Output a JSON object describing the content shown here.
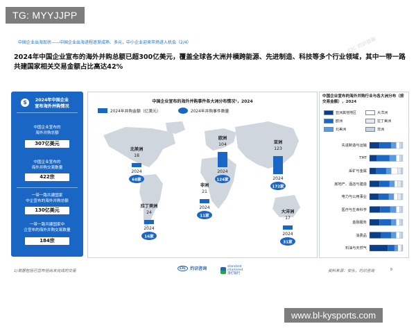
{
  "watermark_top": "TG: MYYJJPP",
  "watermark_bottom": "www.bl-kysports.com",
  "breadcrumb": "中国企业出海现状——中国企业出海进程逐渐成熟、多元，中小企业迎来市场进入机会（2/4）",
  "title": "2024年中国企业宣布的海外并购总额已超300亿美元，覆盖全球各大洲并横跨能源、先进制造、科技等多个行业领域，其中一带一路共建国家相关交易金额占比高达42%",
  "left_panel": {
    "heading_lines": [
      "2024年中国企业",
      "宣布海外并购情况"
    ],
    "icon": "money-icon",
    "items": [
      {
        "label_lines": [
          "中国企业宣布的",
          "海外并购总额"
        ],
        "value": "307亿美元"
      },
      {
        "label_lines": [
          "中国企业宣布的",
          "海外并购交易数量"
        ],
        "value": "422宗"
      },
      {
        "label_lines": [
          "一带一路共建国家",
          "中企宣布的海外并购总额"
        ],
        "value": "130亿美元"
      },
      {
        "label_lines": [
          "一带一路共建国家中",
          "企宣布的海外并购交易数量"
        ],
        "value": "184宗"
      }
    ]
  },
  "map": {
    "title": "中国企业宣布的海外并购事件各大洲分布情况¹，2024",
    "legend_amount": "2024年并购金额（亿美元）",
    "legend_count": "2024年并购事件数量"
  },
  "chart_data": [
    {
      "type": "bar",
      "title": "中国企业宣布的海外并购事件各大洲分布情况¹，2024",
      "categories": [
        "北美洲",
        "欧洲",
        "亚洲",
        "非洲",
        "拉丁美洲",
        "大洋洲"
      ],
      "series": [
        {
          "name": "2024年并购金额（亿美元）",
          "values": [
            18,
            104,
            123,
            21,
            24,
            17
          ]
        },
        {
          "name": "2024年并购事件数量",
          "values": [
            68,
            124,
            172,
            11,
            16,
            31
          ]
        }
      ],
      "x_label": "2024",
      "count_labels": [
        "68家",
        "124家",
        "172家",
        "11家",
        "16家",
        "31家"
      ]
    },
    {
      "type": "bar",
      "orientation": "horizontal",
      "stacked": true,
      "title": "中国企业宣布的海外并购行业与各大洲分布（按交易金额），2024",
      "legend": [
        "亚洲其他地区",
        "大洋洲",
        "欧洲",
        "拉丁美洲",
        "北美洲",
        "非洲"
      ],
      "legend_colors": [
        "#0b3e86",
        "#ffffff",
        "#1a66c4",
        "#e6eaef",
        "#5a9ae0",
        "#c9d3df"
      ],
      "categories": [
        "先进制造与运输",
        "TMT",
        "采矿与金属",
        "房地产、酒店与建造",
        "电力与公用事业",
        "医疗与生命科学",
        "金融服务",
        "消费品",
        "石油与天然气"
      ],
      "series": [
        {
          "name": "亚洲其他地区",
          "values": [
            0.3,
            0.22,
            0.2,
            0.3,
            0.28,
            0.32,
            0.3,
            0.35,
            0.55
          ]
        },
        {
          "name": "欧洲",
          "values": [
            0.35,
            0.38,
            0.3,
            0.3,
            0.3,
            0.3,
            0.35,
            0.3,
            0.2
          ]
        },
        {
          "name": "北美洲",
          "values": [
            0.15,
            0.2,
            0.15,
            0.15,
            0.15,
            0.18,
            0.15,
            0.15,
            0.1
          ]
        },
        {
          "name": "大洋洲",
          "values": [
            0.1,
            0.1,
            0.2,
            0.1,
            0.12,
            0.1,
            0.1,
            0.1,
            0.1
          ]
        },
        {
          "name": "拉丁美洲",
          "values": [
            0.05,
            0.05,
            0.1,
            0.1,
            0.1,
            0.05,
            0.05,
            0.05,
            0.03
          ]
        },
        {
          "name": "非洲",
          "values": [
            0.05,
            0.05,
            0.05,
            0.05,
            0.05,
            0.05,
            0.05,
            0.05,
            0.02
          ]
        }
      ]
    }
  ],
  "footer": {
    "left_note": "1)数据包括已宣布但尚未完成的交易",
    "right_note": "资料来源：安永，灼识咨询",
    "page": "9",
    "logo_cic_text": "灼识咨询",
    "logo_sc_text": [
      "standard",
      "chartered",
      "渣打银行"
    ]
  },
  "watermark_cic": "CIC 灼识咨询",
  "colors": {
    "primary_blue": "#1a66c4",
    "dark_blue": "#0b3e86",
    "light_blue": "#5a9ae0"
  }
}
